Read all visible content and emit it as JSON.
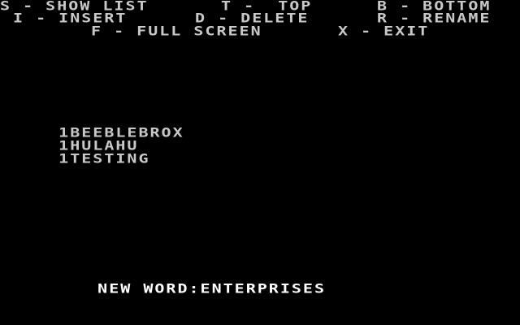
{
  "colors": {
    "background": "#000000",
    "foreground": "#c8c8c8",
    "bright": "#ffffff"
  },
  "menu": {
    "show_list": "S - SHOW LIST",
    "top": "T -  TOP",
    "bottom": "B - BOTTOM",
    "insert": "I - INSERT",
    "delete": "D - DELETE",
    "rename": "R - RENAME",
    "full_screen": "F - FULL SCREEN",
    "exit": "X - EXIT"
  },
  "word_list": [
    "1BEEBLEBROX",
    "1HULAHU",
    "1TESTING"
  ],
  "prompt": {
    "label": "NEW WORD:",
    "value": "ENTERPRISES"
  }
}
